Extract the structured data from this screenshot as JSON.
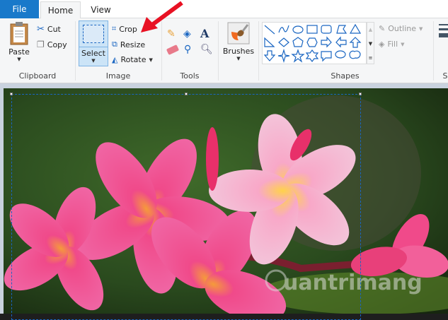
{
  "tabs": {
    "file": "File",
    "home": "Home",
    "view": "View"
  },
  "clipboard": {
    "paste": "Paste",
    "cut": "Cut",
    "copy": "Copy",
    "label": "Clipboard"
  },
  "image": {
    "select": "Select",
    "crop": "Crop",
    "resize": "Resize",
    "rotate": "Rotate",
    "label": "Image"
  },
  "tools": {
    "label": "Tools"
  },
  "brushes": {
    "label": "Brushes"
  },
  "shapes": {
    "label": "Shapes",
    "outline": "Outline",
    "fill": "Fill",
    "next_group_partial": "S"
  },
  "watermark": "uantrimang",
  "colors": {
    "file_tab": "#1979ca",
    "accent_arrow": "#e81123",
    "selection": "#1a66c2"
  }
}
